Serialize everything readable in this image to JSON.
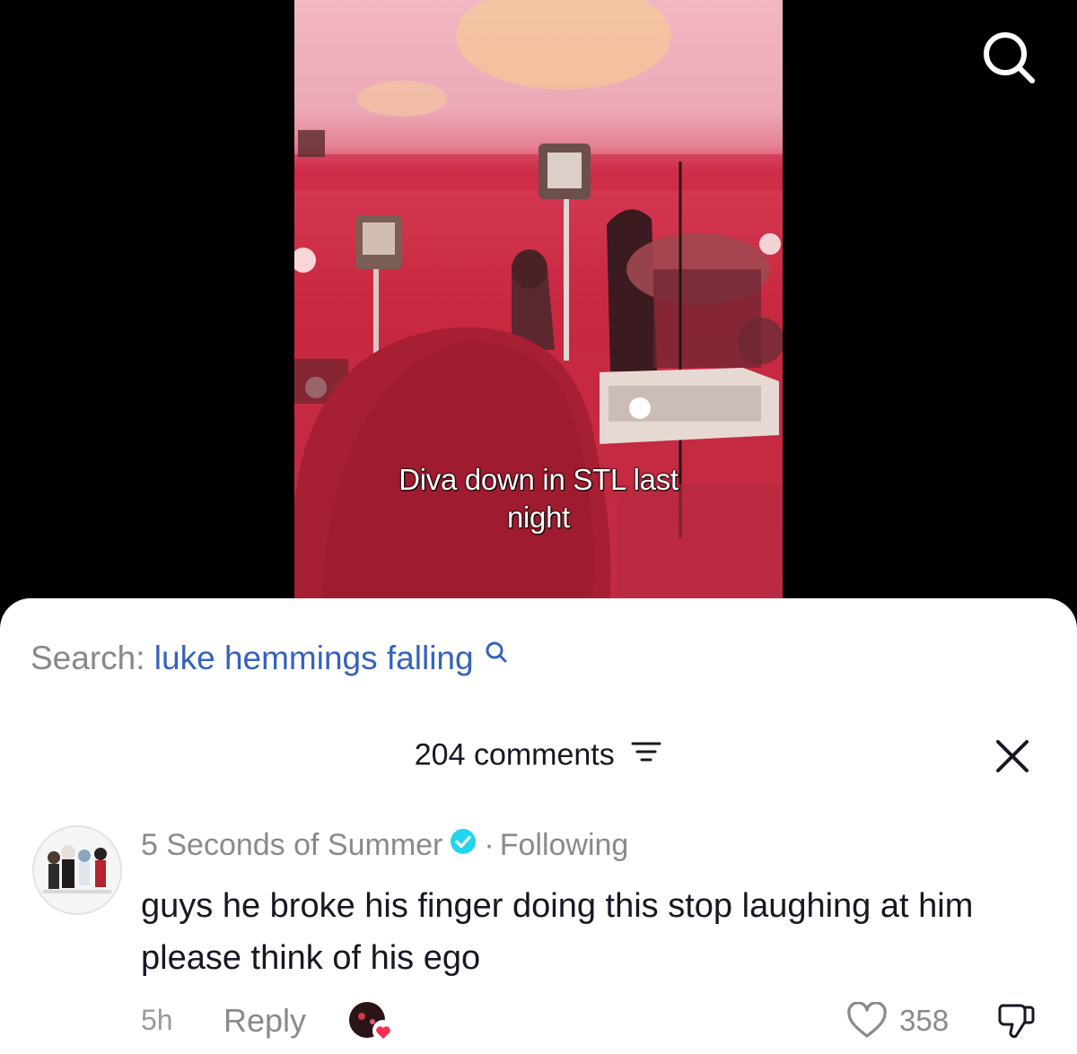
{
  "video": {
    "caption_line1": "Diva down in STL last",
    "caption_line2": "night"
  },
  "top_search_icon": "search-icon",
  "sheet": {
    "search_prefix": "Search:",
    "search_query": "luke hemmings falling",
    "comment_count_label": "204 comments",
    "comments": [
      {
        "author": "5 Seconds of Summer",
        "verified": true,
        "separator": "·",
        "relation": "Following",
        "text": "guys he broke his finger doing this stop laughing at him please think of his ego",
        "time": "5h",
        "reply_label": "Reply",
        "likes": "358"
      }
    ]
  },
  "colors": {
    "link_blue": "#3462bf",
    "verified_blue": "#20d5ec",
    "heart_red": "#fe2c55"
  }
}
